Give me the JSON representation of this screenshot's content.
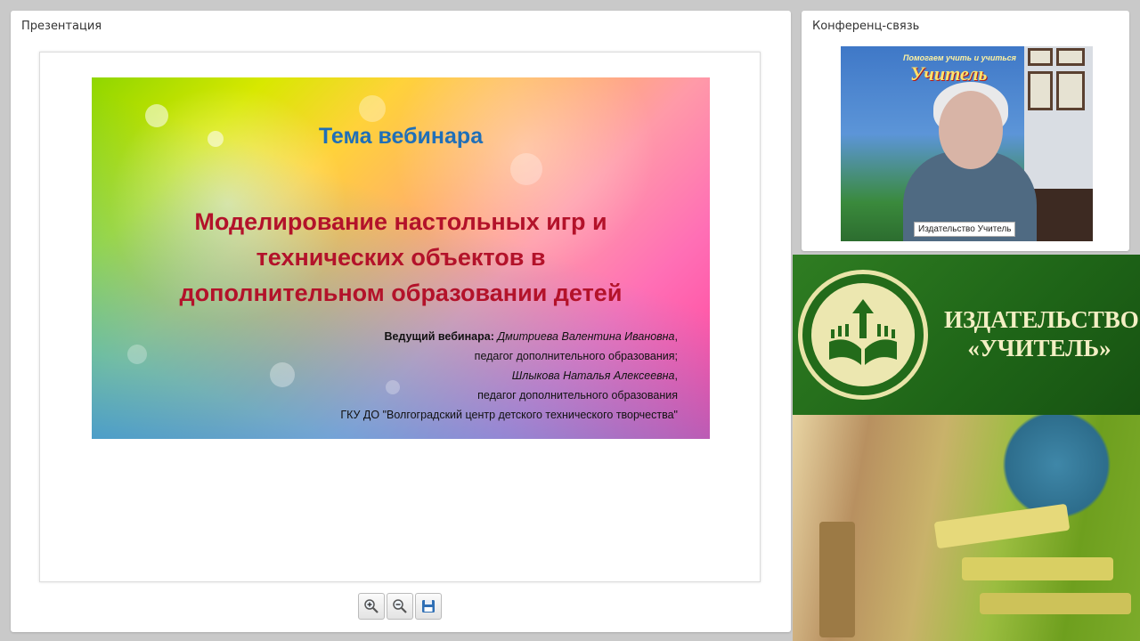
{
  "presentation": {
    "title": "Презентация",
    "slide": {
      "heading": "Тема вебинара",
      "topic_lines": [
        "Моделирование настольных игр и",
        "технических объектов в",
        "дополнительном образовании детей"
      ],
      "host_label": "Ведущий вебинара:",
      "host_1_name": "Дмитриева Валентина Ивановна",
      "host_1_role": "педагог дополнительного образования;",
      "host_2_name": "Шлыкова Наталья Алексеевна",
      "host_2_role": "педагог дополнительного образования",
      "organization": "ГКУ ДО \"Волгоградский центр детского технического творчества\""
    },
    "toolbar": {
      "zoom_in_icon": "zoom-in-icon",
      "zoom_out_icon": "zoom-out-icon",
      "save_icon": "save-icon"
    }
  },
  "conference": {
    "title": "Конференц-связь",
    "participant_name": "Издательство Учитель",
    "banner_slogan": "Помогаем учить и учиться",
    "banner_brand": "Учитель"
  },
  "promo": {
    "publisher_line_1": "ИЗДАТЕЛЬСТВО",
    "publisher_line_2": "«УЧИТЕЛЬ»"
  },
  "colors": {
    "slide_heading": "#1f6fb8",
    "slide_topic": "#b3122a",
    "promo_green": "#236b1a",
    "promo_text": "#f3efc4"
  }
}
